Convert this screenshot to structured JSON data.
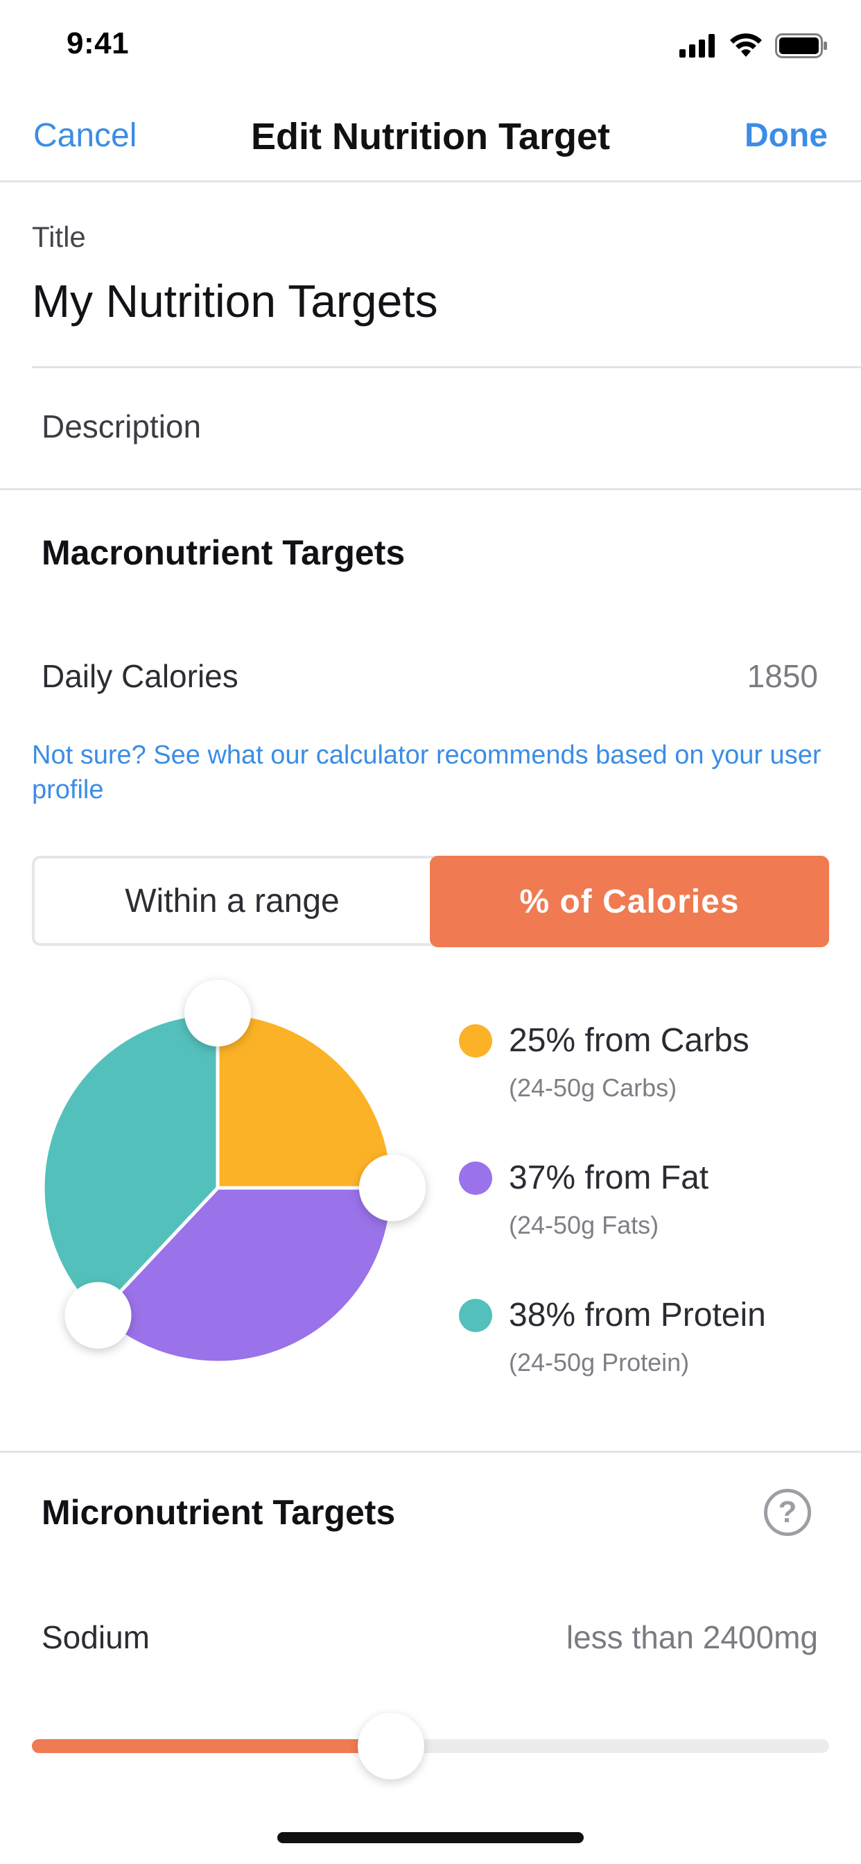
{
  "status_bar": {
    "time": "9:41"
  },
  "nav": {
    "cancel": "Cancel",
    "title": "Edit Nutrition Target",
    "done": "Done"
  },
  "form": {
    "title_label": "Title",
    "title_value": "My Nutrition Targets",
    "description_placeholder": "Description"
  },
  "macro": {
    "section_title": "Macronutrient Targets",
    "daily_calories_label": "Daily Calories",
    "daily_calories_value": "1850",
    "calculator_link": "Not sure? See what our calculator recommends based on your user profile",
    "segments": {
      "left": "Within a range",
      "right": "% of Calories",
      "selected": "right"
    },
    "legend": [
      {
        "main": "25% from Carbs",
        "sub": "(24-50g Carbs)",
        "color": "#fbb226"
      },
      {
        "main": "37% from Fat",
        "sub": "(24-50g Fats)",
        "color": "#9a72e9"
      },
      {
        "main": "38% from Protein",
        "sub": "(24-50g Protein)",
        "color": "#54c0bb"
      }
    ]
  },
  "chart_data": {
    "type": "pie",
    "categories": [
      "Carbs",
      "Fat",
      "Protein"
    ],
    "values": [
      25,
      37,
      38
    ],
    "colors": [
      "#fbb226",
      "#9a72e9",
      "#54c0bb"
    ],
    "title": ""
  },
  "micro": {
    "section_title": "Micronutrient Targets",
    "help_glyph": "?",
    "sodium_label": "Sodium",
    "sodium_value": "less than 2400mg",
    "sodium_slider_fraction": 0.45
  },
  "colors": {
    "accent": "#f07a51",
    "link": "#3b8de5"
  }
}
